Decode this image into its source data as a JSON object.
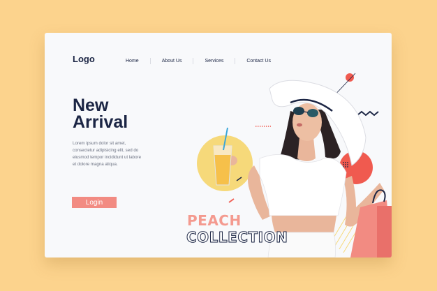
{
  "header": {
    "logo": "Logo",
    "nav": [
      "Home",
      "About Us",
      "Services",
      "Contact Us"
    ]
  },
  "hero": {
    "headline_line1": "New",
    "headline_line2": "Arrival",
    "description": "Lorem ipsum dolor sit amet, consectetur adipisicing elit, sed do eiusmod tempor incididunt ut labore et dolore magna aliqua.",
    "login_label": "Login",
    "collection_line1": "PEACH",
    "collection_line2": "COLLECTION"
  },
  "colors": {
    "background": "#fcd38d",
    "card": "#f8f9fb",
    "primary_text": "#1b2544",
    "accent": "#f28b82",
    "circle_yellow": "#f6d97a",
    "circle_red": "#f05a4f"
  }
}
